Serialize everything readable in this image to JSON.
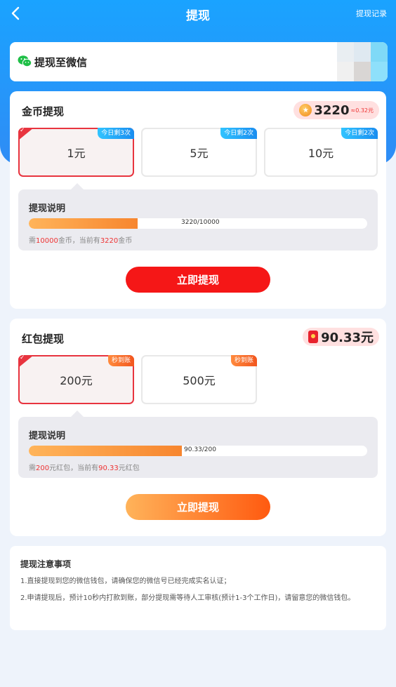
{
  "header": {
    "title": "提现",
    "back_icon": "back-arrow-icon",
    "record_link": "提现记录",
    "bg_color": "#2196f3"
  },
  "wechat": {
    "icon": "wechat-icon",
    "label": "提现至微信"
  },
  "coin_section": {
    "title": "金币提现",
    "balance": "3220",
    "balance_sub": "≈0.32元",
    "options": [
      {
        "amount": "1元",
        "tag": "今日剩3次",
        "selected": true
      },
      {
        "amount": "5元",
        "tag": "今日剩2次",
        "selected": false
      },
      {
        "amount": "10元",
        "tag": "今日剩2次",
        "selected": false
      }
    ],
    "info": {
      "title": "提现说明",
      "progress_text": "3220/10000",
      "progress_value": 0.322,
      "note_prefix": "需",
      "note_need": "10000",
      "note_mid": "金币，当前有",
      "note_have": "3220",
      "note_suffix": "金币"
    },
    "button": "立即提现"
  },
  "redpack_section": {
    "title": "红包提现",
    "balance": "90.33元",
    "options": [
      {
        "amount": "200元",
        "tag": "秒到账",
        "selected": true
      },
      {
        "amount": "500元",
        "tag": "秒到账",
        "selected": false
      }
    ],
    "info": {
      "title": "提现说明",
      "progress_text": "90.33/200",
      "progress_value": 0.45165,
      "note_prefix": "需",
      "note_need": "200",
      "note_mid": "元红包，当前有",
      "note_have": "90.33",
      "note_suffix": "元红包"
    },
    "button": "立即提现"
  },
  "notes": {
    "title": "提现注意事项",
    "lines": [
      "1.直接提现到您的微信钱包，请确保您的微信号已经完成实名认证；",
      "2.申请提现后，预计10秒内打款到账，部分提现需等待人工审核(预计1-3个工作日)，请留意您的微信钱包。"
    ]
  },
  "colors": {
    "accent_red": "#f51717",
    "accent_orange": "#ff5a10",
    "highlight": "#e33333"
  }
}
